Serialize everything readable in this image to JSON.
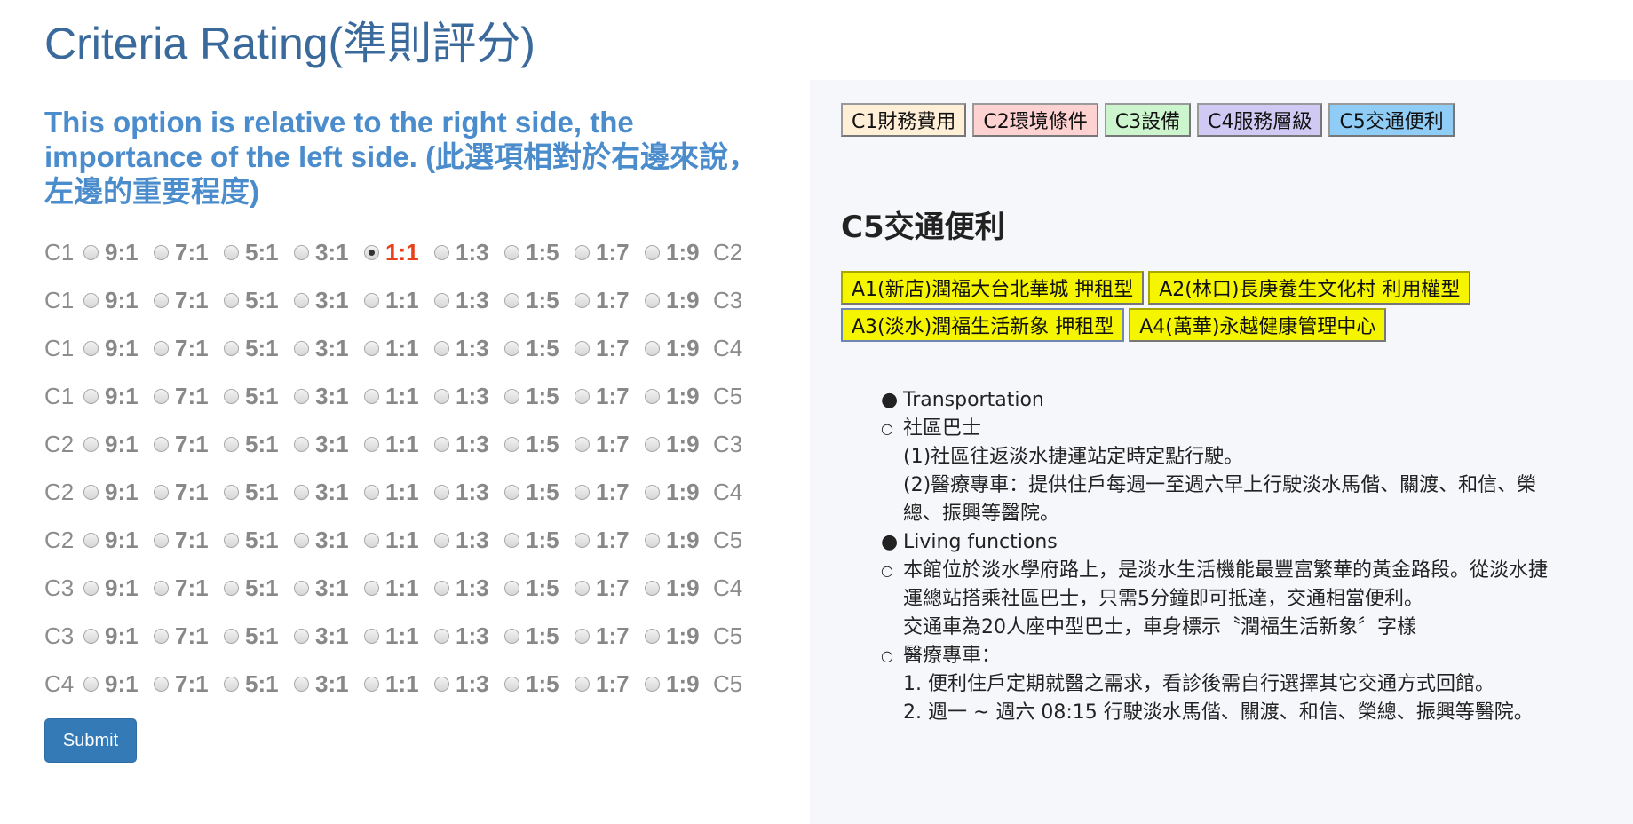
{
  "page": {
    "title": "Criteria Rating(準則評分)"
  },
  "instruction": "This option is relative to the right side, the importance of the left side. (此選項相對於右邊來說，左邊的重要程度)",
  "scale": [
    "9:1",
    "7:1",
    "5:1",
    "3:1",
    "1:1",
    "1:3",
    "1:5",
    "1:7",
    "1:9"
  ],
  "comparisons": [
    {
      "left": "C1",
      "right": "C2",
      "selected": "1:1"
    },
    {
      "left": "C1",
      "right": "C3",
      "selected": null
    },
    {
      "left": "C1",
      "right": "C4",
      "selected": null
    },
    {
      "left": "C1",
      "right": "C5",
      "selected": null
    },
    {
      "left": "C2",
      "right": "C3",
      "selected": null
    },
    {
      "left": "C2",
      "right": "C4",
      "selected": null
    },
    {
      "left": "C2",
      "right": "C5",
      "selected": null
    },
    {
      "left": "C3",
      "right": "C4",
      "selected": null
    },
    {
      "left": "C3",
      "right": "C5",
      "selected": null
    },
    {
      "left": "C4",
      "right": "C5",
      "selected": null
    }
  ],
  "submit_label": "Submit",
  "criteria_tabs": [
    {
      "label": "C1財務費用",
      "color": "#ffefd6"
    },
    {
      "label": "C2環境條件",
      "color": "#ffd2d2"
    },
    {
      "label": "C3設備",
      "color": "#cdf5cd"
    },
    {
      "label": "C4服務層級",
      "color": "#cfc9f4"
    },
    {
      "label": "C5交通便利",
      "color": "#8fccf6"
    }
  ],
  "active_criterion": "C5交通便利",
  "alternatives": [
    {
      "label": "A1(新店)潤福大台北華城  押租型"
    },
    {
      "label": "A2(林口)長庚養生文化村 利用權型"
    },
    {
      "label": "A3(淡水)潤福生活新象 押租型"
    },
    {
      "label": "A4(萬華)永越健康管理中心"
    }
  ],
  "details": {
    "transportation": {
      "heading": "Transportation",
      "items": [
        {
          "title": "社區巴士",
          "lines": [
            "(1)社區往返淡水捷運站定時定點行駛。",
            "(2)醫療專車：提供住戶每週一至週六早上行駛淡水馬偕、關渡、和信、榮總、振興等醫院。"
          ]
        }
      ]
    },
    "living": {
      "heading": "Living functions",
      "items": [
        {
          "title": "本館位於淡水學府路上，是淡水生活機能最豐富繁華的黃金路段。從淡水捷運總站搭乘社區巴士，只需5分鐘即可抵達，交通相當便利。",
          "lines": [
            "交通車為20人座中型巴士，車身標示〝潤福生活新象〞字樣"
          ]
        },
        {
          "title": "醫療專車：",
          "lines": [
            "1. 便利住戶定期就醫之需求，看診後需自行選擇其它交通方式回館。",
            "2. 週一 ~ 週六 08:15 行駛淡水馬偕、關渡、和信、榮總、振興等醫院。"
          ]
        }
      ]
    }
  }
}
